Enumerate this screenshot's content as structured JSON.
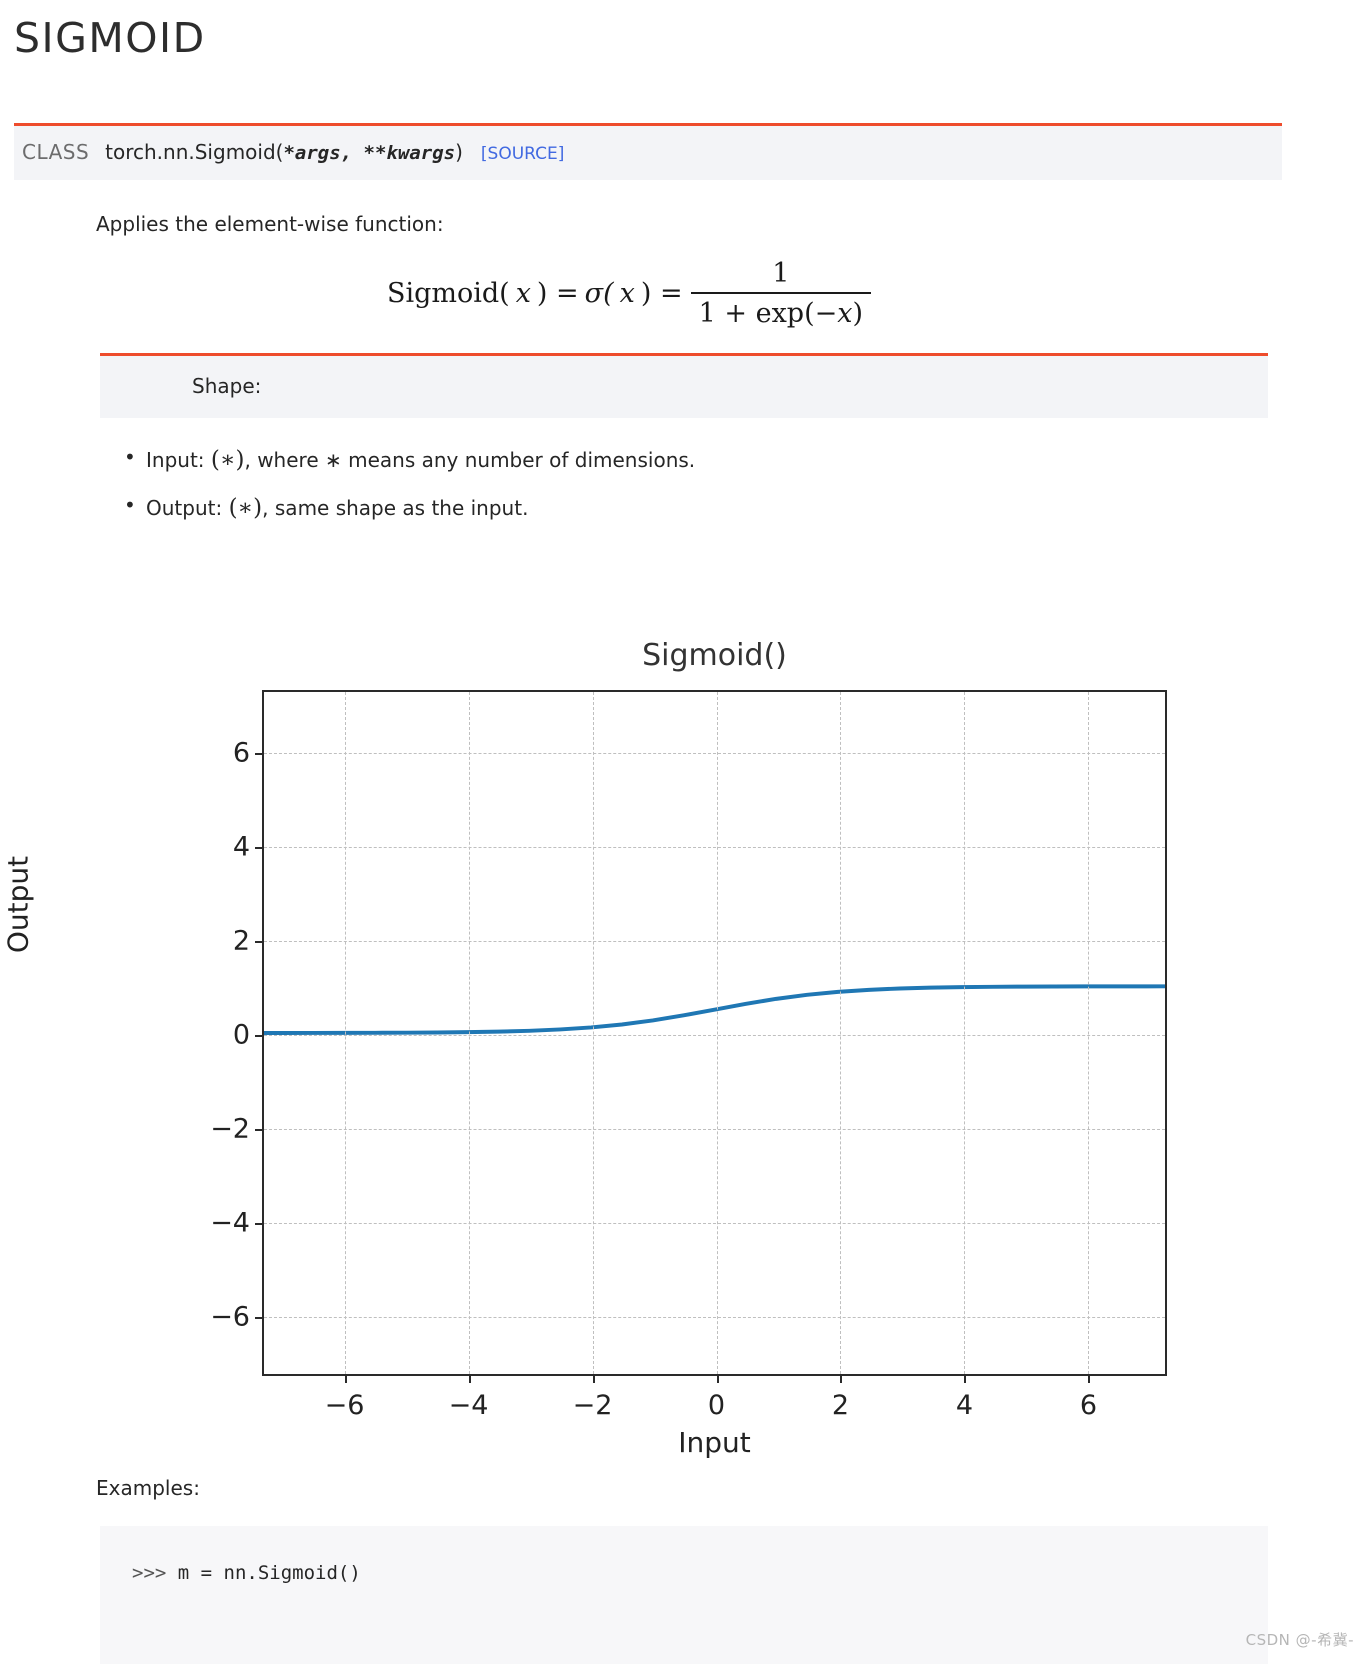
{
  "page_title": "SIGMOID",
  "signature": {
    "kind": "CLASS",
    "qualified_name": "torch.nn.Sigmoid",
    "open_paren": "(",
    "args": "*args, **kwargs",
    "close_paren": ")",
    "source_link": "[SOURCE]"
  },
  "intro": "Applies the element-wise function:",
  "formula": {
    "lhs": "Sigmoid(",
    "lhs_var": "x",
    "lhs_close": ") =",
    "sigma": "σ(",
    "sigma_var": "x",
    "sigma_close": ") =",
    "numerator": "1",
    "denominator_pre": "1 + exp(−",
    "denominator_var": "x",
    "denominator_post": ")",
    "plain": "Sigmoid(x) = σ(x) = 1 / (1 + exp(−x))"
  },
  "shape": {
    "heading": "Shape:",
    "items": [
      {
        "prefix": "Input:",
        "star": "(∗)",
        "rest": ", where ∗ means any number of dimensions."
      },
      {
        "prefix": "Output:",
        "star": "(∗)",
        "rest": ", same shape as the input."
      }
    ]
  },
  "examples": {
    "label": "Examples:",
    "lines": [
      {
        "prompt": ">>> ",
        "code": "m = nn.Sigmoid()"
      }
    ]
  },
  "watermark": "CSDN @-希冀-",
  "colors": {
    "accent": "#ee4c2c",
    "panel": "#f3f4f7",
    "link": "#4169e1",
    "curve": "#1f77b4",
    "grid": "#bfbfbf",
    "axis": "#2a2a2a"
  },
  "chart_data": {
    "type": "line",
    "title": "Sigmoid()",
    "xlabel": "Input",
    "ylabel": "Output",
    "xlim": [
      -7.3,
      7.3
    ],
    "ylim": [
      -7.3,
      7.3
    ],
    "xticks": [
      -6,
      -4,
      -2,
      0,
      2,
      4,
      6
    ],
    "xtick_labels": [
      "−6",
      "−4",
      "−2",
      "0",
      "2",
      "4",
      "6"
    ],
    "yticks": [
      6,
      4,
      2,
      0,
      -2,
      -4,
      -6
    ],
    "ytick_labels": [
      "6",
      "4",
      "2",
      "0",
      "−2",
      "−4",
      "−6"
    ],
    "grid": true,
    "grid_style": "dashed",
    "legend": null,
    "series": [
      {
        "name": "Sigmoid()",
        "color": "#1f77b4",
        "linewidth": 4,
        "x": [
          -7.3,
          -7.0,
          -6.5,
          -6.0,
          -5.5,
          -5.0,
          -4.5,
          -4.0,
          -3.5,
          -3.0,
          -2.5,
          -2.0,
          -1.5,
          -1.0,
          -0.5,
          0.0,
          0.5,
          1.0,
          1.5,
          2.0,
          2.5,
          3.0,
          3.5,
          4.0,
          4.5,
          5.0,
          5.5,
          6.0,
          6.5,
          7.0,
          7.3
        ],
        "y": [
          0.00068,
          0.00091,
          0.0015,
          0.0025,
          0.0041,
          0.0067,
          0.011,
          0.018,
          0.029,
          0.047,
          0.076,
          0.119,
          0.182,
          0.269,
          0.378,
          0.5,
          0.622,
          0.731,
          0.818,
          0.881,
          0.924,
          0.953,
          0.971,
          0.982,
          0.989,
          0.993,
          0.9959,
          0.9975,
          0.9985,
          0.9991,
          0.99932
        ]
      }
    ]
  }
}
